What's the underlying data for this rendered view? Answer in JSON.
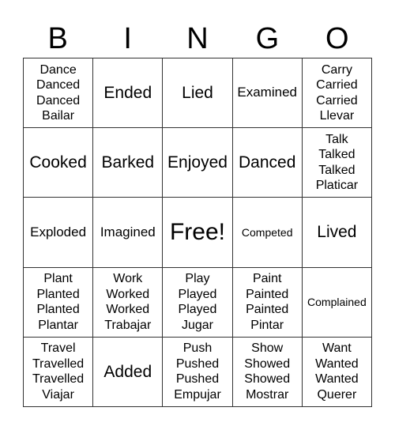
{
  "header": {
    "letters": [
      "B",
      "I",
      "N",
      "G",
      "O"
    ]
  },
  "cells": [
    "Dance\nDanced\nDanced\nBailar",
    "Ended",
    "Lied",
    "Examined",
    "Carry\nCarried\nCarried\nLlevar",
    "Cooked",
    "Barked",
    "Enjoyed",
    "Danced",
    "Talk\nTalked\nTalked\nPlaticar",
    "Exploded",
    "Imagined",
    "Free!",
    "Competed",
    "Lived",
    "Plant\nPlanted\nPlanted\nPlantar",
    "Work\nWorked\nWorked\nTrabajar",
    "Play\nPlayed\nPlayed\nJugar",
    "Paint\nPainted\nPainted\nPintar",
    "Complained",
    "Travel\nTravelled\nTravelled\nViajar",
    "Added",
    "Push\nPushed\nPushed\nEmpujar",
    "Show\nShowed\nShowed\nMostrar",
    "Want\nWanted\nWanted\nQuerer"
  ]
}
